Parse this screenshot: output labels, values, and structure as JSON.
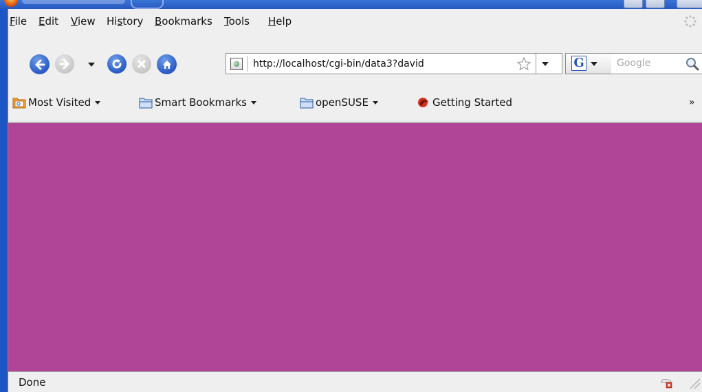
{
  "colors": {
    "page_background": "#b04497",
    "chrome": "#efefef",
    "nav_button_blue": "#2d5fc9",
    "nav_button_disabled": "#c8c8c8"
  },
  "menu": {
    "items": [
      {
        "label": "File",
        "mnemonic": "F"
      },
      {
        "label": "Edit",
        "mnemonic": "E"
      },
      {
        "label": "View",
        "mnemonic": "V"
      },
      {
        "label": "History",
        "mnemonic": "s"
      },
      {
        "label": "Bookmarks",
        "mnemonic": "B"
      },
      {
        "label": "Tools",
        "mnemonic": "T"
      },
      {
        "label": "Help",
        "mnemonic": "H"
      }
    ]
  },
  "navigation": {
    "back_icon": "back-arrow-icon",
    "forward_icon": "forward-arrow-icon",
    "reload_icon": "reload-icon",
    "stop_icon": "stop-icon",
    "home_icon": "home-icon"
  },
  "address_bar": {
    "url": "http://localhost/cgi-bin/data3?david"
  },
  "search": {
    "engine_letter": "G",
    "placeholder": "Google"
  },
  "bookmarks": {
    "items": [
      {
        "label": "Most Visited"
      },
      {
        "label": "Smart Bookmarks"
      },
      {
        "label": "openSUSE"
      },
      {
        "label": "Getting Started"
      }
    ],
    "overflow": "»"
  },
  "status": {
    "text": "Done"
  }
}
